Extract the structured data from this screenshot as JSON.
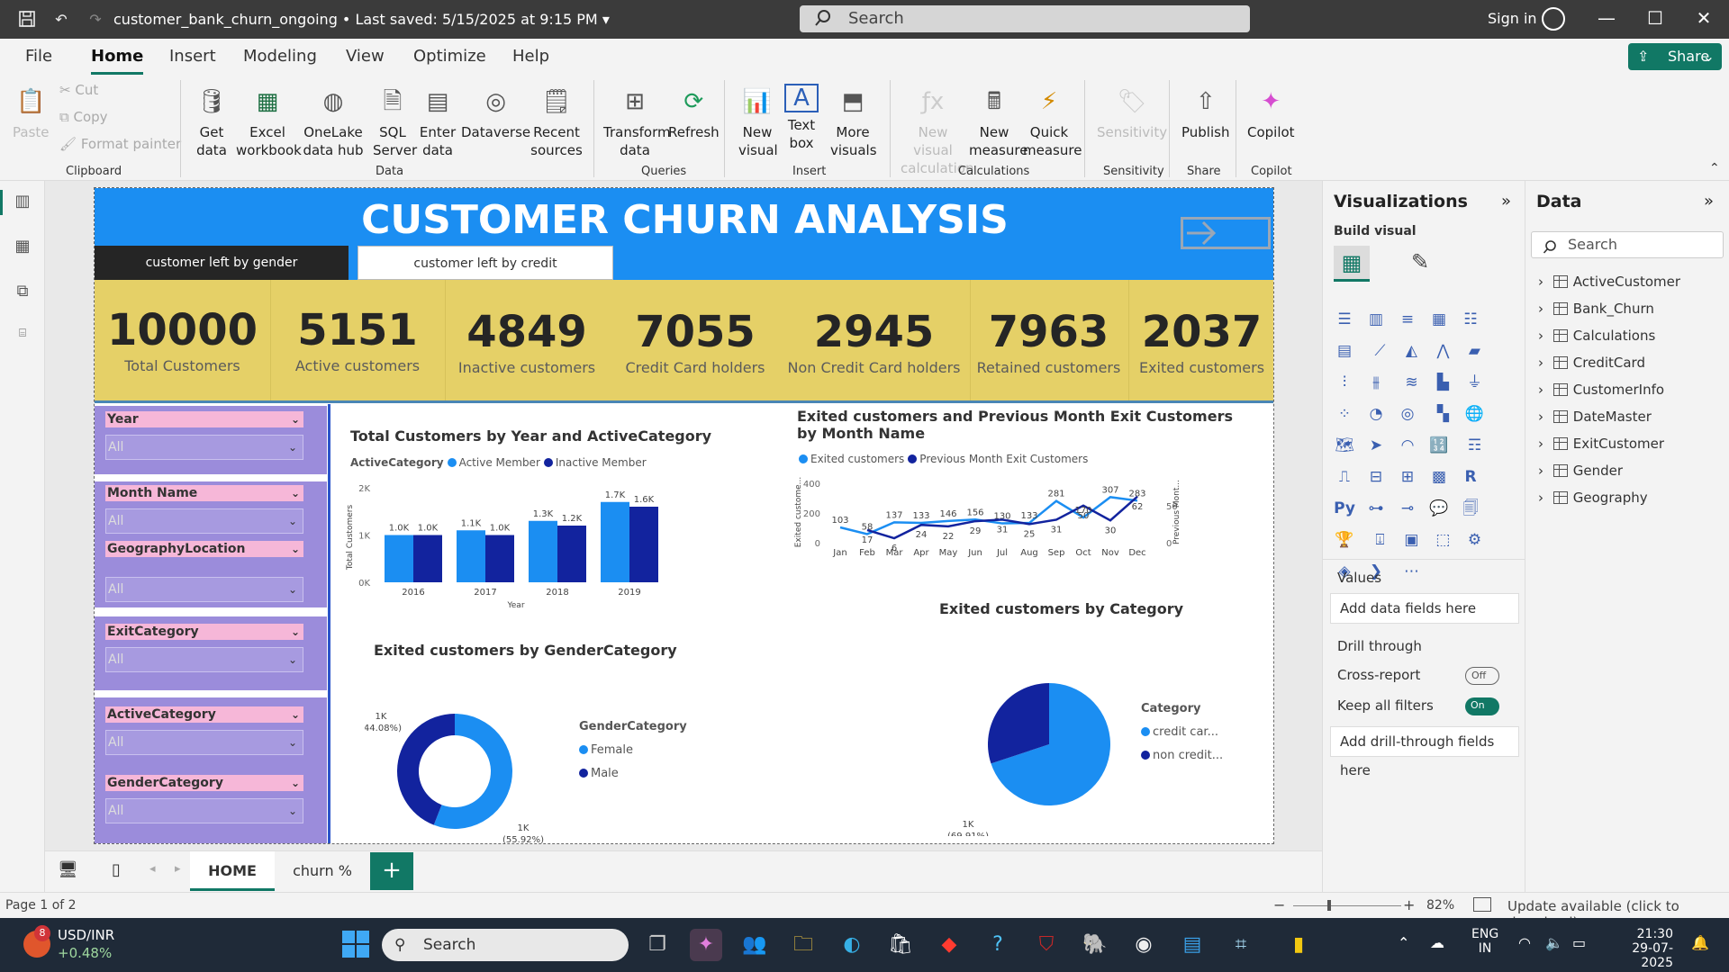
{
  "titlebar": {
    "doc_title": "customer_bank_churn_ongoing • Last saved: 5/15/2025 at 9:15 PM",
    "search_placeholder": "Search",
    "signin": "Sign in"
  },
  "menu": [
    "File",
    "Home",
    "Insert",
    "Modeling",
    "View",
    "Optimize",
    "Help"
  ],
  "share": "Share",
  "ribbon": {
    "clipboard": {
      "paste": "Paste",
      "cut": "Cut",
      "copy": "Copy",
      "format_painter": "Format painter",
      "label": "Clipboard"
    },
    "data": {
      "items": [
        "Get data",
        "Excel workbook",
        "OneLake data hub",
        "SQL Server",
        "Enter data",
        "Dataverse",
        "Recent sources"
      ],
      "label": "Data"
    },
    "queries": {
      "items": [
        "Transform data",
        "Refresh"
      ],
      "label": "Queries"
    },
    "insert": {
      "items": [
        "New visual",
        "Text box",
        "More visuals"
      ],
      "label": "Insert"
    },
    "calculations": {
      "items": [
        "New visual calculation",
        "New measure",
        "Quick measure"
      ],
      "label": "Calculations"
    },
    "sensitivity": {
      "items": [
        "Sensitivity"
      ],
      "label": "Sensitivity"
    },
    "share": {
      "items": [
        "Publish"
      ],
      "label": "Share"
    },
    "copilot": {
      "items": [
        "Copilot"
      ],
      "label": "Copilot"
    }
  },
  "report": {
    "title": "CUSTOMER CHURN ANALYSIS",
    "buttons": {
      "gender": "customer left by gender",
      "credit": "customer left by credit"
    },
    "kpis": [
      {
        "value": "10000",
        "label": "Total Customers"
      },
      {
        "value": "5151",
        "label": "Active customers"
      },
      {
        "value": "4849",
        "label": "Inactive customers"
      },
      {
        "value": "7055",
        "label": "Credit Card holders"
      },
      {
        "value": "2945",
        "label": "Non Credit Card holders"
      },
      {
        "value": "7963",
        "label": "Retained customers"
      },
      {
        "value": "2037",
        "label": "Exited customers"
      }
    ],
    "slicers": [
      {
        "name": "Year",
        "value": "All"
      },
      {
        "name": "Month Name",
        "value": "All"
      },
      {
        "name": "GeographyLocation",
        "value": "All"
      },
      {
        "name": "ExitCategory",
        "value": "All"
      },
      {
        "name": "ActiveCategory",
        "value": "All"
      },
      {
        "name": "GenderCategory",
        "value": "All"
      }
    ]
  },
  "chart_data": [
    {
      "type": "bar",
      "title": "Total Customers by Year and ActiveCategory",
      "legend_title": "ActiveCategory",
      "categories": [
        "2016",
        "2017",
        "2018",
        "2019"
      ],
      "series": [
        {
          "name": "Active Member",
          "values": [
            1000,
            1100,
            1300,
            1700
          ],
          "labels": [
            "1.0K",
            "1.1K",
            "1.3K",
            "1.7K"
          ],
          "color": "#1b8ef2"
        },
        {
          "name": "Inactive Member",
          "values": [
            1000,
            1000,
            1200,
            1600
          ],
          "labels": [
            "1.0K",
            "1.0K",
            "1.2K",
            "1.6K"
          ],
          "color": "#12239e"
        }
      ],
      "xlabel": "Year",
      "ylabel": "Total Customers",
      "ylim": [
        0,
        2000
      ],
      "yticks": [
        "0K",
        "1K",
        "2K"
      ]
    },
    {
      "type": "line",
      "title": "Exited customers and Previous Month Exit Customers by Month Name",
      "categories": [
        "Jan",
        "Feb",
        "Mar",
        "Apr",
        "May",
        "Jun",
        "Jul",
        "Aug",
        "Sep",
        "Oct",
        "Nov",
        "Dec"
      ],
      "series": [
        {
          "name": "Exited customers",
          "values": [
            103,
            58,
            137,
            133,
            146,
            156,
            130,
            133,
            281,
            170,
            307,
            283
          ],
          "color": "#1b8ef2"
        },
        {
          "name": "Previous Month Exit Customers",
          "values": [
            null,
            17,
            6,
            24,
            22,
            29,
            31,
            25,
            31,
            50,
            30,
            62
          ],
          "color": "#12239e"
        }
      ],
      "ylabel": "Exited custome...",
      "y2label": "Previous Mont...",
      "ylim": [
        0,
        400
      ],
      "yticks": [
        "0",
        "200",
        "400"
      ],
      "y2ticks": [
        "0",
        "50"
      ]
    },
    {
      "type": "pie",
      "title": "Exited customers by GenderCategory",
      "legend_title": "GenderCategory",
      "donut": true,
      "slices": [
        {
          "name": "Female",
          "value": 55.92,
          "label": "1K",
          "pct": "(55.92%)",
          "color": "#1b8ef2"
        },
        {
          "name": "Male",
          "value": 44.08,
          "label": "1K",
          "pct": "(44.08%)",
          "color": "#12239e"
        }
      ]
    },
    {
      "type": "pie",
      "title": "Exited customers by Category",
      "legend_title": "Category",
      "slices": [
        {
          "name": "credit car...",
          "value": 69.91,
          "label": "1K",
          "pct": "(69.91%)",
          "color": "#1b8ef2"
        },
        {
          "name": "non credit...",
          "value": 30.09,
          "label": "1K",
          "pct": "(30.09%)",
          "color": "#12239e"
        }
      ]
    }
  ],
  "page_tabs": [
    "HOME",
    "churn %"
  ],
  "viz_pane": {
    "title": "Visualizations",
    "build_visual": "Build visual",
    "values": "Values",
    "add_fields": "Add data fields here",
    "drill_through": "Drill through",
    "cross_report": "Cross-report",
    "cross_report_state": "Off",
    "keep_filters": "Keep all filters",
    "keep_filters_state": "On",
    "add_drill": "Add drill-through fields here"
  },
  "data_pane": {
    "title": "Data",
    "search_placeholder": "Search",
    "tables": [
      "ActiveCustomer",
      "Bank_Churn",
      "Calculations",
      "CreditCard",
      "CustomerInfo",
      "DateMaster",
      "ExitCustomer",
      "Gender",
      "Geography"
    ]
  },
  "status": {
    "page": "Page 1 of 2",
    "zoom": "82%",
    "update": "Update available (click to download)"
  },
  "taskbar": {
    "stock_badge": "8",
    "stock_name": "USD/INR",
    "stock_change": "+0.48%",
    "search": "Search",
    "lang1": "ENG",
    "lang2": "IN",
    "time": "21:30",
    "date": "29-07-2025"
  }
}
